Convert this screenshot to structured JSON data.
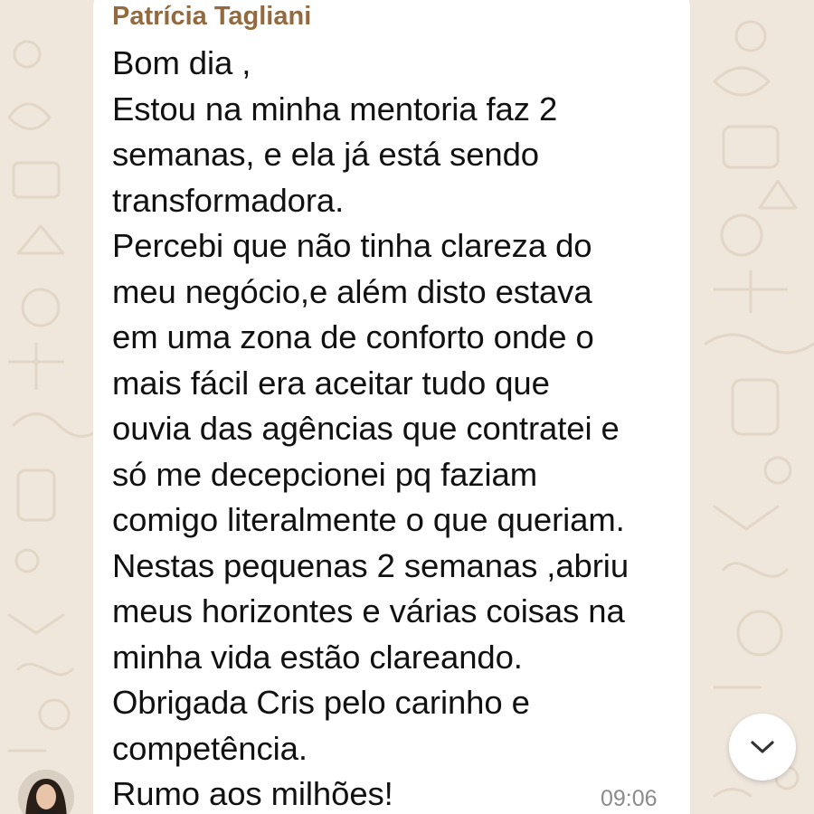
{
  "chat": {
    "sender_name": "Patrícia Tagliani",
    "message_lines": [
      "Bom dia ,",
      "Estou na minha mentoria faz 2",
      "semanas, e ela já está sendo",
      "transformadora.",
      "Percebi que não tinha clareza do",
      "meu negócio,e além disto estava",
      "em uma zona de conforto onde o",
      "mais fácil era aceitar tudo que",
      "ouvia das agências que contratei e",
      "só me decepcionei pq faziam",
      "comigo literalmente o que queriam.",
      "Nestas pequenas 2 semanas ,abriu",
      "meus horizontes e várias coisas na",
      "minha vida estão clareando.",
      "Obrigada Cris pelo carinho e",
      "competência.",
      "Rumo aos milhões!"
    ],
    "timestamp": "09:06"
  },
  "icons": {
    "scroll_down": "chevron-down-icon",
    "avatar": "sender-avatar"
  },
  "colors": {
    "wallpaper": "#efe7dc",
    "wallpaper_doodle": "#e3d8c9",
    "bubble": "#ffffff",
    "sender_name": "#936a3f",
    "message_text": "#111111",
    "timestamp": "#8b8b8b"
  }
}
